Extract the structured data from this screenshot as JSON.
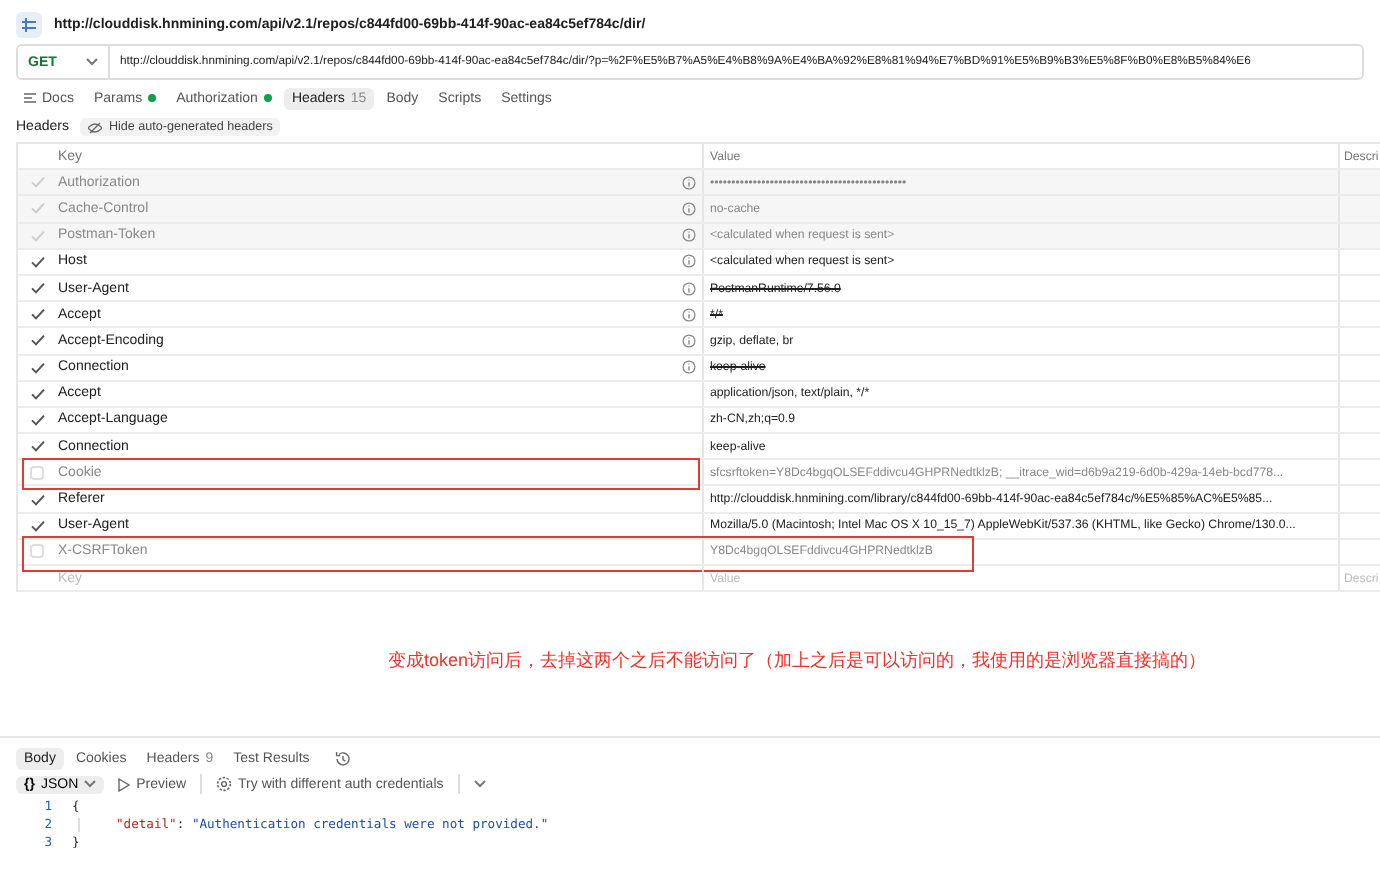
{
  "request": {
    "title": "http://clouddisk.hnmining.com/api/v2.1/repos/c844fd00-69bb-414f-90ac-ea84c5ef784c/dir/",
    "method": "GET",
    "url": "http://clouddisk.hnmining.com/api/v2.1/repos/c844fd00-69bb-414f-90ac-ea84c5ef784c/dir/?p=%2F%E5%B7%A5%E4%B8%9A%E4%BA%92%E8%81%94%E7%BD%91%E5%B9%B3%E5%8F%B0%E8%B5%84%E6"
  },
  "tabs": [
    {
      "label": "Docs",
      "selected": false,
      "dot": false
    },
    {
      "label": "Params",
      "selected": false,
      "dot": true
    },
    {
      "label": "Authorization",
      "selected": false,
      "dot": true
    },
    {
      "label": "Headers",
      "count": "15",
      "selected": true,
      "dot": false
    },
    {
      "label": "Body",
      "selected": false,
      "dot": false
    },
    {
      "label": "Scripts",
      "selected": false,
      "dot": false
    },
    {
      "label": "Settings",
      "selected": false,
      "dot": false
    }
  ],
  "headers_bar": {
    "label": "Headers",
    "toggle": "Hide auto-generated headers"
  },
  "table": {
    "columns": [
      "Key",
      "Value",
      "Descri"
    ],
    "rows": [
      {
        "key": "Authorization",
        "value": "••••••••••••••••••••••••••••••••••••••••••••••",
        "checked": true,
        "auto": true,
        "info": true,
        "struck": false,
        "boxed": false
      },
      {
        "key": "Cache-Control",
        "value": "no-cache",
        "checked": true,
        "auto": true,
        "info": true,
        "struck": false,
        "boxed": false
      },
      {
        "key": "Postman-Token",
        "value": "<calculated when request is sent>",
        "checked": true,
        "auto": true,
        "info": true,
        "struck": false,
        "boxed": false
      },
      {
        "key": "Host",
        "value": "<calculated when request is sent>",
        "checked": true,
        "auto": false,
        "info": true,
        "struck": false,
        "boxed": false
      },
      {
        "key": "User-Agent",
        "value": "PostmanRuntime/7.56.0",
        "checked": true,
        "auto": false,
        "info": true,
        "struck": true,
        "boxed": false
      },
      {
        "key": "Accept",
        "value": "*/*",
        "checked": true,
        "auto": false,
        "info": true,
        "struck": true,
        "boxed": false
      },
      {
        "key": "Accept-Encoding",
        "value": "gzip, deflate, br",
        "checked": true,
        "auto": false,
        "info": true,
        "struck": false,
        "boxed": false
      },
      {
        "key": "Connection",
        "value": "keep-alive",
        "checked": true,
        "auto": false,
        "info": true,
        "struck": true,
        "boxed": false
      },
      {
        "key": "Accept",
        "value": "application/json, text/plain, */*",
        "checked": true,
        "auto": false,
        "info": false,
        "struck": false,
        "boxed": false
      },
      {
        "key": "Accept-Language",
        "value": "zh-CN,zh;q=0.9",
        "checked": true,
        "auto": false,
        "info": false,
        "struck": false,
        "boxed": false
      },
      {
        "key": "Connection",
        "value": "keep-alive",
        "checked": true,
        "auto": false,
        "info": false,
        "struck": false,
        "boxed": false
      },
      {
        "key": "Cookie",
        "value": "sfcsrftoken=Y8Dc4bgqOLSEFddivcu4GHPRNedtklzB; __itrace_wid=d6b9a219-6d0b-429a-14eb-bcd778...",
        "checked": false,
        "auto": false,
        "info": false,
        "struck": false,
        "boxed": true,
        "box_wide": false
      },
      {
        "key": "Referer",
        "value": "http://clouddisk.hnmining.com/library/c844fd00-69bb-414f-90ac-ea84c5ef784c/%E5%85%AC%E5%85...",
        "checked": true,
        "auto": false,
        "info": false,
        "struck": false,
        "boxed": false
      },
      {
        "key": "User-Agent",
        "value": "Mozilla/5.0 (Macintosh; Intel Mac OS X 10_15_7) AppleWebKit/537.36 (KHTML, like Gecko) Chrome/130.0...",
        "checked": true,
        "auto": false,
        "info": false,
        "struck": false,
        "boxed": false
      },
      {
        "key": "X-CSRFToken",
        "value": "Y8Dc4bgqOLSEFddivcu4GHPRNedtklzB",
        "checked": false,
        "auto": false,
        "info": false,
        "struck": false,
        "boxed": true,
        "box_wide": true
      }
    ],
    "new_row": {
      "key_placeholder": "Key",
      "value_placeholder": "Value",
      "description_placeholder": "Descri"
    }
  },
  "note": "变成token访问后，去掉这两个之后不能访问了（加上之后是可以访问的，我使用的是浏览器直接搞的）",
  "response": {
    "tabs": [
      {
        "label": "Body",
        "selected": true
      },
      {
        "label": "Cookies",
        "selected": false
      },
      {
        "label": "Headers",
        "count": "9",
        "selected": false
      },
      {
        "label": "Test Results",
        "selected": false
      }
    ],
    "format_glyph": "{}",
    "format": "JSON",
    "preview": "Preview",
    "auth_button": "Try with different auth credentials",
    "lines": [
      {
        "number": "1",
        "kind": "brace",
        "text": "{"
      },
      {
        "number": "2",
        "kind": "pair",
        "key": "\"detail\"",
        "colon": ":",
        "value": "\"Authentication credentials were not provided.\""
      },
      {
        "number": "3",
        "kind": "brace",
        "text": "}"
      }
    ]
  }
}
